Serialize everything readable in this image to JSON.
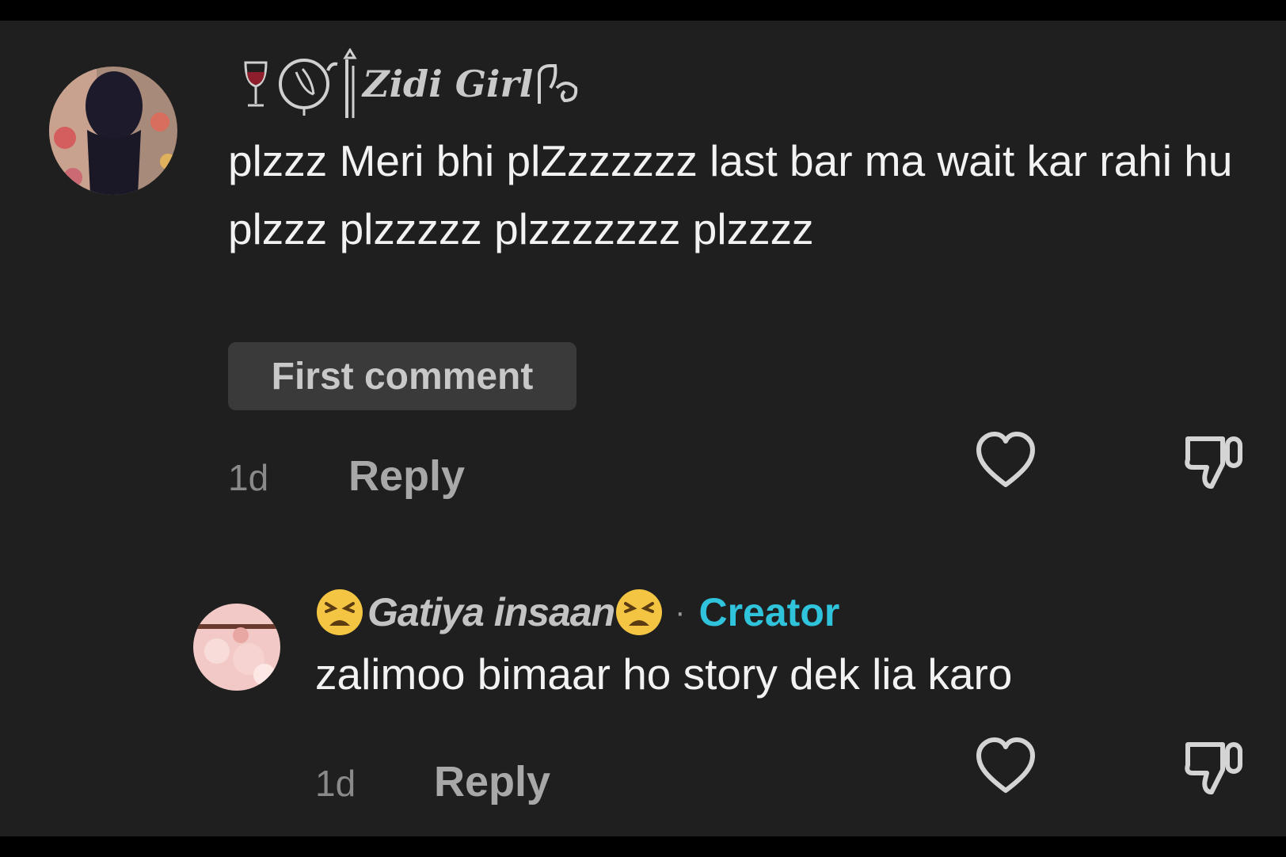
{
  "comment": {
    "username": "Zidi Girl",
    "text": "plzzz Meri bhi plZzzzzzz last bar ma wait kar rahi hu plzzz plzzzzz plzzzzzzz plzzzz",
    "badge": "First comment",
    "time": "1d",
    "reply_label": "Reply",
    "icons": [
      "wine-glass-icon",
      "like-heart-icon",
      "dislike-icon"
    ]
  },
  "reply": {
    "username": "Gatiya insaan",
    "separator": "·",
    "creator_label": "Creator",
    "text": "zalimoo bimaar ho story dek lia karo",
    "time": "1d",
    "reply_label": "Reply",
    "icons": [
      "tired-face-emoji-icon",
      "like-heart-icon",
      "dislike-icon"
    ]
  },
  "colors": {
    "background": "#1f1f1f",
    "creator_accent": "#2fc3dc",
    "chip_background": "#3a3a3a"
  }
}
